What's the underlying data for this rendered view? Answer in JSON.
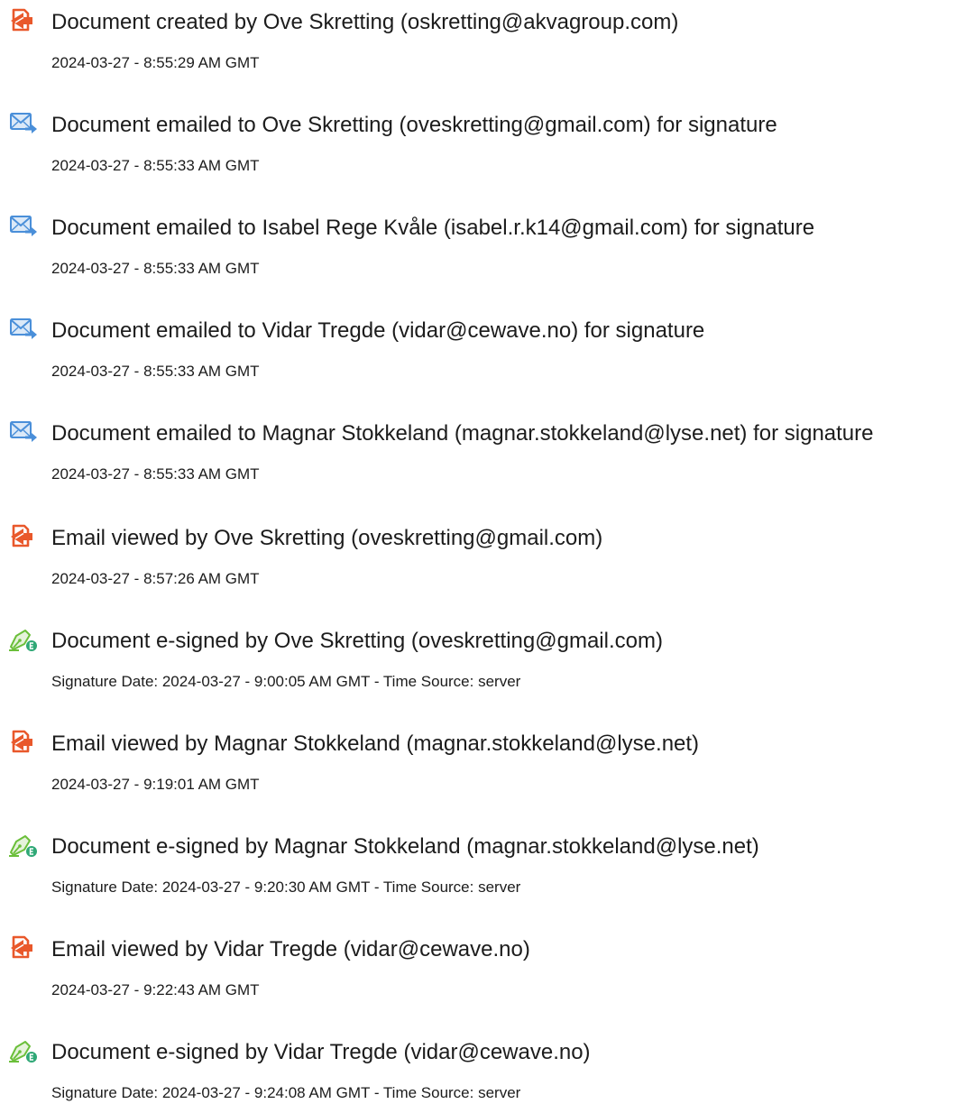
{
  "colors": {
    "created_icon": "#e9582b",
    "email_icon": "#4a8fd9",
    "signed_icon": "#6bbf3a",
    "signed_badge": "#2fa876"
  },
  "events": [
    {
      "icon": "document-icon",
      "title": "Document created by Ove Skretting (oskretting@akvagroup.com)",
      "date": "2024-03-27 - 8:55:29 AM GMT"
    },
    {
      "icon": "email-send-icon",
      "title": "Document emailed to Ove Skretting (oveskretting@gmail.com) for signature",
      "date": "2024-03-27 - 8:55:33 AM GMT"
    },
    {
      "icon": "email-send-icon",
      "title": "Document emailed to Isabel Rege Kvåle (isabel.r.k14@gmail.com) for signature",
      "date": "2024-03-27 - 8:55:33 AM GMT"
    },
    {
      "icon": "email-send-icon",
      "title": "Document emailed to Vidar Tregde (vidar@cewave.no) for signature",
      "date": "2024-03-27 - 8:55:33 AM GMT"
    },
    {
      "icon": "email-send-icon",
      "title": "Document emailed to Magnar Stokkeland (magnar.stokkeland@lyse.net) for signature",
      "date": "2024-03-27 - 8:55:33 AM GMT"
    },
    {
      "icon": "document-icon",
      "title": "Email viewed by Ove Skretting (oveskretting@gmail.com)",
      "date": "2024-03-27 - 8:57:26 AM GMT"
    },
    {
      "icon": "esign-pen-icon",
      "title": "Document e-signed by Ove Skretting (oveskretting@gmail.com)",
      "date": "Signature Date: 2024-03-27 - 9:00:05 AM GMT - Time Source: server"
    },
    {
      "icon": "document-icon",
      "title": "Email viewed by Magnar Stokkeland (magnar.stokkeland@lyse.net)",
      "date": "2024-03-27 - 9:19:01 AM GMT"
    },
    {
      "icon": "esign-pen-icon",
      "title": "Document e-signed by Magnar Stokkeland (magnar.stokkeland@lyse.net)",
      "date": "Signature Date: 2024-03-27 - 9:20:30 AM GMT - Time Source: server"
    },
    {
      "icon": "document-icon",
      "title": "Email viewed by Vidar Tregde (vidar@cewave.no)",
      "date": "2024-03-27 - 9:22:43 AM GMT"
    },
    {
      "icon": "esign-pen-icon",
      "title": "Document e-signed by Vidar Tregde (vidar@cewave.no)",
      "date": "Signature Date: 2024-03-27 - 9:24:08 AM GMT - Time Source: server"
    }
  ]
}
